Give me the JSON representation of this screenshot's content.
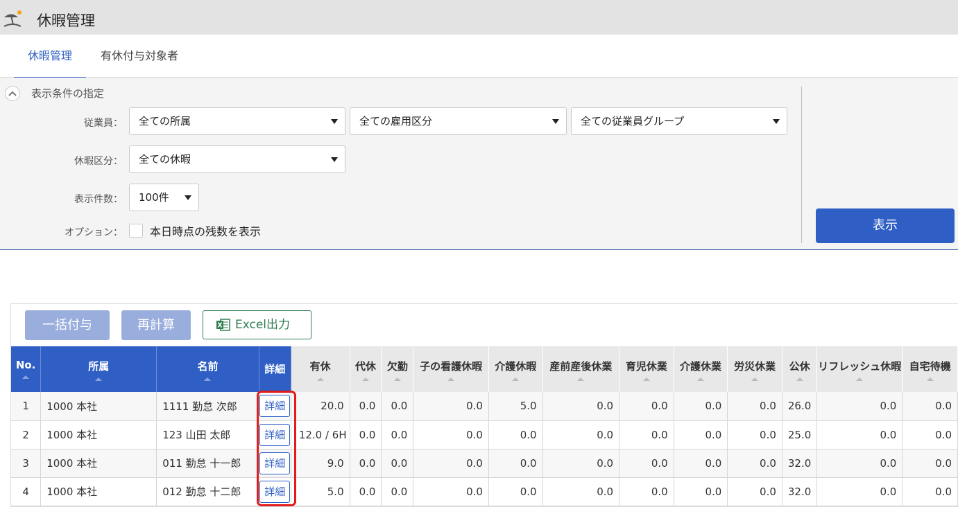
{
  "app": {
    "title": "休暇管理"
  },
  "tabs": [
    {
      "label": "休暇管理",
      "active": true
    },
    {
      "label": "有休付与対象者",
      "active": false
    }
  ],
  "filter": {
    "section_title": "表示条件の指定",
    "employee_label": "従業員：",
    "affiliation_value": "全ての所属",
    "employment_type_value": "全ての雇用区分",
    "employee_group_value": "全ての従業員グループ",
    "leave_type_label": "休暇区分：",
    "leave_type_value": "全ての休暇",
    "count_label": "表示件数：",
    "count_value": "100件",
    "option_label": "オプション：",
    "option_checkbox_label": "本日時点の残数を表示",
    "option_checked": false,
    "show_button": "表示"
  },
  "toolbar": {
    "bulk_grant": "一括付与",
    "recalc": "再計算",
    "excel": "Excel出力"
  },
  "colors": {
    "primary": "#2f5fc4",
    "highlight": "#e21b1b",
    "excel_green": "#2e7d4f"
  },
  "table": {
    "headers": [
      "No.",
      "所属",
      "名前",
      "詳細",
      "有休",
      "代休",
      "欠勤",
      "子の看護休暇",
      "介護休暇",
      "産前産後休業",
      "育児休業",
      "介護休業",
      "労災休業",
      "公休",
      "リフレッシュ休暇",
      "自宅待機"
    ],
    "detail_label": "詳細",
    "rows": [
      [
        "1",
        "1000 本社",
        "1111 勤怠 次郎",
        "20.0",
        "0.0",
        "0.0",
        "0.0",
        "5.0",
        "0.0",
        "0.0",
        "0.0",
        "0.0",
        "26.0",
        "0.0",
        "0.0"
      ],
      [
        "2",
        "1000 本社",
        "123 山田 太郎",
        "12.0 / 6H",
        "0.0",
        "0.0",
        "0.0",
        "0.0",
        "0.0",
        "0.0",
        "0.0",
        "0.0",
        "25.0",
        "0.0",
        "0.0"
      ],
      [
        "3",
        "1000 本社",
        "011 勤怠 十一郎",
        "9.0",
        "0.0",
        "0.0",
        "0.0",
        "0.0",
        "0.0",
        "0.0",
        "0.0",
        "0.0",
        "32.0",
        "0.0",
        "0.0"
      ],
      [
        "4",
        "1000 本社",
        "012 勤怠 十二郎",
        "5.0",
        "0.0",
        "0.0",
        "0.0",
        "0.0",
        "0.0",
        "0.0",
        "0.0",
        "0.0",
        "32.0",
        "0.0",
        "0.0"
      ]
    ]
  }
}
